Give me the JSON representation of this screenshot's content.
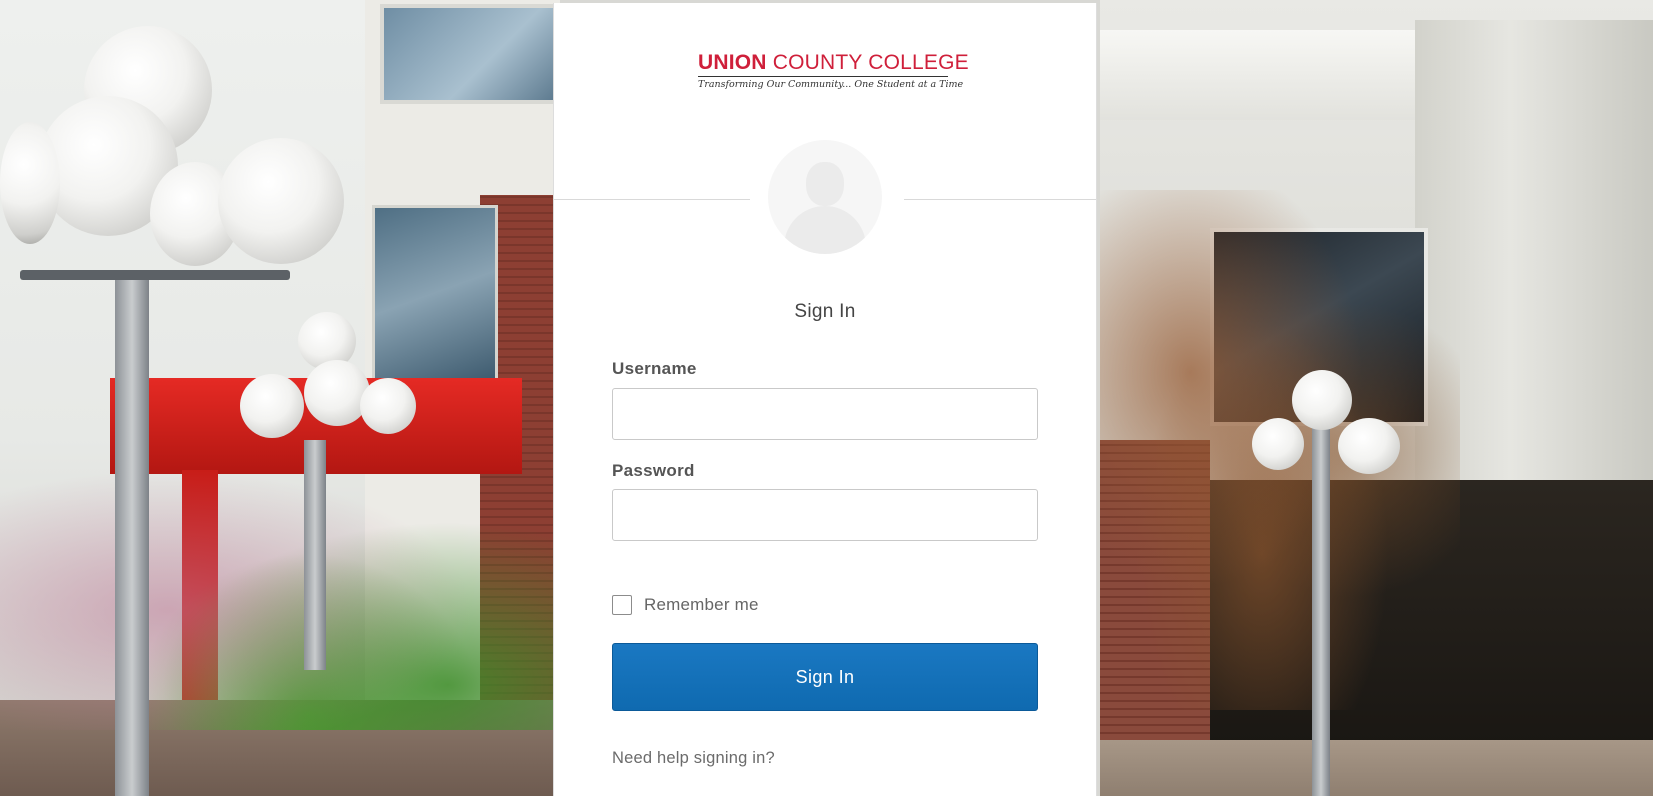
{
  "logo": {
    "name_bold": "UNION",
    "name_rest": " COUNTY COLLEGE",
    "tagline": "Transforming Our Community... One Student at a Time"
  },
  "form": {
    "title": "Sign In",
    "username_label": "Username",
    "username_value": "",
    "password_label": "Password",
    "password_value": "",
    "remember_label": "Remember me",
    "remember_checked": false,
    "submit_label": "Sign In",
    "help_link": "Need help signing in?"
  },
  "colors": {
    "brand_red": "#cf1f3a",
    "button_blue": "#1272b9"
  },
  "icons": {
    "avatar": "user-silhouette-icon"
  }
}
